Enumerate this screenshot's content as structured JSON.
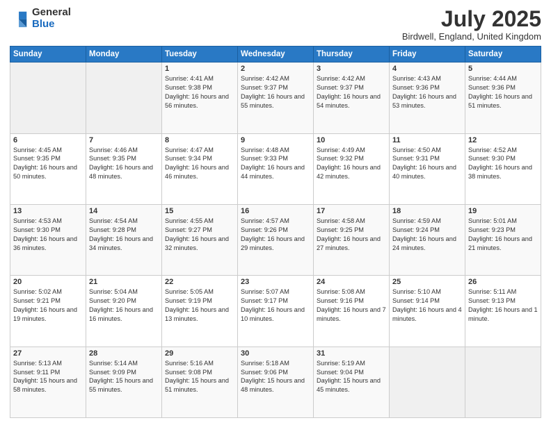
{
  "header": {
    "logo_general": "General",
    "logo_blue": "Blue",
    "month_year": "July 2025",
    "location": "Birdwell, England, United Kingdom"
  },
  "weekdays": [
    "Sunday",
    "Monday",
    "Tuesday",
    "Wednesday",
    "Thursday",
    "Friday",
    "Saturday"
  ],
  "weeks": [
    [
      {
        "day": "",
        "sunrise": "",
        "sunset": "",
        "daylight": ""
      },
      {
        "day": "",
        "sunrise": "",
        "sunset": "",
        "daylight": ""
      },
      {
        "day": "1",
        "sunrise": "Sunrise: 4:41 AM",
        "sunset": "Sunset: 9:38 PM",
        "daylight": "Daylight: 16 hours and 56 minutes."
      },
      {
        "day": "2",
        "sunrise": "Sunrise: 4:42 AM",
        "sunset": "Sunset: 9:37 PM",
        "daylight": "Daylight: 16 hours and 55 minutes."
      },
      {
        "day": "3",
        "sunrise": "Sunrise: 4:42 AM",
        "sunset": "Sunset: 9:37 PM",
        "daylight": "Daylight: 16 hours and 54 minutes."
      },
      {
        "day": "4",
        "sunrise": "Sunrise: 4:43 AM",
        "sunset": "Sunset: 9:36 PM",
        "daylight": "Daylight: 16 hours and 53 minutes."
      },
      {
        "day": "5",
        "sunrise": "Sunrise: 4:44 AM",
        "sunset": "Sunset: 9:36 PM",
        "daylight": "Daylight: 16 hours and 51 minutes."
      }
    ],
    [
      {
        "day": "6",
        "sunrise": "Sunrise: 4:45 AM",
        "sunset": "Sunset: 9:35 PM",
        "daylight": "Daylight: 16 hours and 50 minutes."
      },
      {
        "day": "7",
        "sunrise": "Sunrise: 4:46 AM",
        "sunset": "Sunset: 9:35 PM",
        "daylight": "Daylight: 16 hours and 48 minutes."
      },
      {
        "day": "8",
        "sunrise": "Sunrise: 4:47 AM",
        "sunset": "Sunset: 9:34 PM",
        "daylight": "Daylight: 16 hours and 46 minutes."
      },
      {
        "day": "9",
        "sunrise": "Sunrise: 4:48 AM",
        "sunset": "Sunset: 9:33 PM",
        "daylight": "Daylight: 16 hours and 44 minutes."
      },
      {
        "day": "10",
        "sunrise": "Sunrise: 4:49 AM",
        "sunset": "Sunset: 9:32 PM",
        "daylight": "Daylight: 16 hours and 42 minutes."
      },
      {
        "day": "11",
        "sunrise": "Sunrise: 4:50 AM",
        "sunset": "Sunset: 9:31 PM",
        "daylight": "Daylight: 16 hours and 40 minutes."
      },
      {
        "day": "12",
        "sunrise": "Sunrise: 4:52 AM",
        "sunset": "Sunset: 9:30 PM",
        "daylight": "Daylight: 16 hours and 38 minutes."
      }
    ],
    [
      {
        "day": "13",
        "sunrise": "Sunrise: 4:53 AM",
        "sunset": "Sunset: 9:30 PM",
        "daylight": "Daylight: 16 hours and 36 minutes."
      },
      {
        "day": "14",
        "sunrise": "Sunrise: 4:54 AM",
        "sunset": "Sunset: 9:28 PM",
        "daylight": "Daylight: 16 hours and 34 minutes."
      },
      {
        "day": "15",
        "sunrise": "Sunrise: 4:55 AM",
        "sunset": "Sunset: 9:27 PM",
        "daylight": "Daylight: 16 hours and 32 minutes."
      },
      {
        "day": "16",
        "sunrise": "Sunrise: 4:57 AM",
        "sunset": "Sunset: 9:26 PM",
        "daylight": "Daylight: 16 hours and 29 minutes."
      },
      {
        "day": "17",
        "sunrise": "Sunrise: 4:58 AM",
        "sunset": "Sunset: 9:25 PM",
        "daylight": "Daylight: 16 hours and 27 minutes."
      },
      {
        "day": "18",
        "sunrise": "Sunrise: 4:59 AM",
        "sunset": "Sunset: 9:24 PM",
        "daylight": "Daylight: 16 hours and 24 minutes."
      },
      {
        "day": "19",
        "sunrise": "Sunrise: 5:01 AM",
        "sunset": "Sunset: 9:23 PM",
        "daylight": "Daylight: 16 hours and 21 minutes."
      }
    ],
    [
      {
        "day": "20",
        "sunrise": "Sunrise: 5:02 AM",
        "sunset": "Sunset: 9:21 PM",
        "daylight": "Daylight: 16 hours and 19 minutes."
      },
      {
        "day": "21",
        "sunrise": "Sunrise: 5:04 AM",
        "sunset": "Sunset: 9:20 PM",
        "daylight": "Daylight: 16 hours and 16 minutes."
      },
      {
        "day": "22",
        "sunrise": "Sunrise: 5:05 AM",
        "sunset": "Sunset: 9:19 PM",
        "daylight": "Daylight: 16 hours and 13 minutes."
      },
      {
        "day": "23",
        "sunrise": "Sunrise: 5:07 AM",
        "sunset": "Sunset: 9:17 PM",
        "daylight": "Daylight: 16 hours and 10 minutes."
      },
      {
        "day": "24",
        "sunrise": "Sunrise: 5:08 AM",
        "sunset": "Sunset: 9:16 PM",
        "daylight": "Daylight: 16 hours and 7 minutes."
      },
      {
        "day": "25",
        "sunrise": "Sunrise: 5:10 AM",
        "sunset": "Sunset: 9:14 PM",
        "daylight": "Daylight: 16 hours and 4 minutes."
      },
      {
        "day": "26",
        "sunrise": "Sunrise: 5:11 AM",
        "sunset": "Sunset: 9:13 PM",
        "daylight": "Daylight: 16 hours and 1 minute."
      }
    ],
    [
      {
        "day": "27",
        "sunrise": "Sunrise: 5:13 AM",
        "sunset": "Sunset: 9:11 PM",
        "daylight": "Daylight: 15 hours and 58 minutes."
      },
      {
        "day": "28",
        "sunrise": "Sunrise: 5:14 AM",
        "sunset": "Sunset: 9:09 PM",
        "daylight": "Daylight: 15 hours and 55 minutes."
      },
      {
        "day": "29",
        "sunrise": "Sunrise: 5:16 AM",
        "sunset": "Sunset: 9:08 PM",
        "daylight": "Daylight: 15 hours and 51 minutes."
      },
      {
        "day": "30",
        "sunrise": "Sunrise: 5:18 AM",
        "sunset": "Sunset: 9:06 PM",
        "daylight": "Daylight: 15 hours and 48 minutes."
      },
      {
        "day": "31",
        "sunrise": "Sunrise: 5:19 AM",
        "sunset": "Sunset: 9:04 PM",
        "daylight": "Daylight: 15 hours and 45 minutes."
      },
      {
        "day": "",
        "sunrise": "",
        "sunset": "",
        "daylight": ""
      },
      {
        "day": "",
        "sunrise": "",
        "sunset": "",
        "daylight": ""
      }
    ]
  ]
}
